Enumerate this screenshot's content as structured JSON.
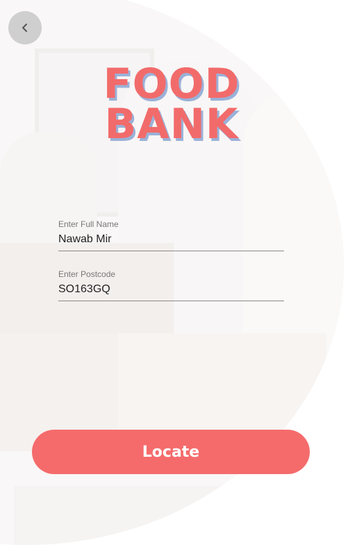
{
  "colors": {
    "accent": "#f56b6b",
    "logo_shadow": "#9ab1d8",
    "back_button_bg": "#cfcfcf"
  },
  "header": {
    "back_icon": "chevron-left-icon"
  },
  "logo": {
    "line1": "FOOD",
    "line2": "BANK"
  },
  "form": {
    "name": {
      "label": "Enter Full Name",
      "value": "Nawab Mir"
    },
    "postcode": {
      "label": "Enter Postcode",
      "value": "SO163GQ"
    }
  },
  "actions": {
    "locate_label": "Locate"
  }
}
